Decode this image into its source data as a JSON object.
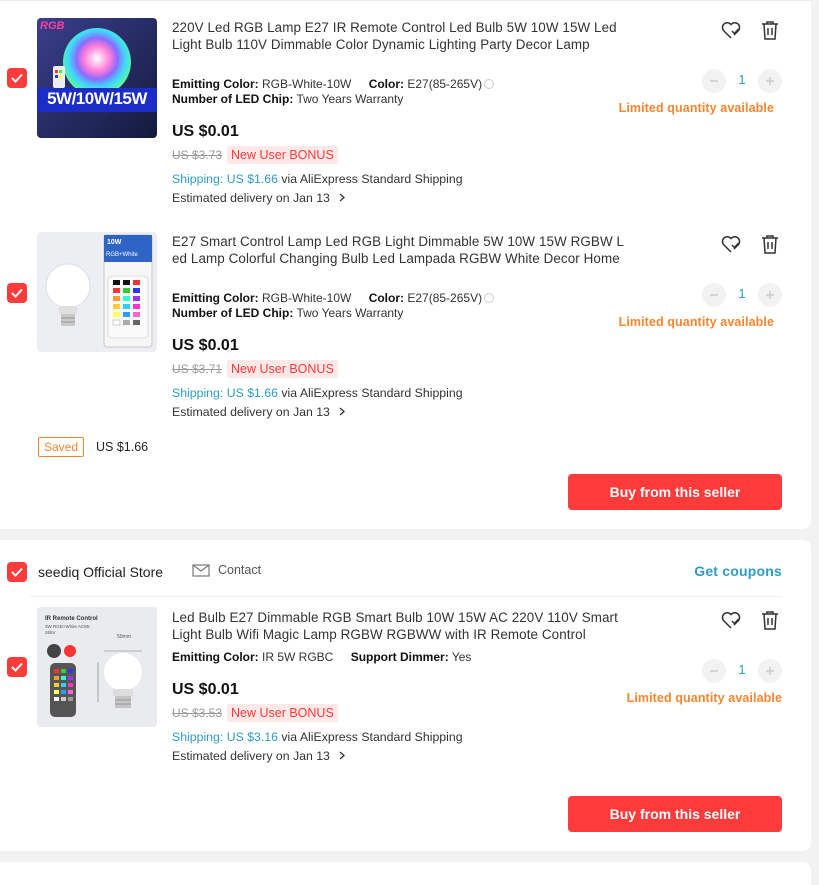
{
  "colors": {
    "accent": "#fd3b3b",
    "link": "#2e9cc3",
    "warning": "#f7852e"
  },
  "seller1": {
    "saved_label": "Saved",
    "saved_amount": "US $1.66",
    "buy_label": "Buy from this seller",
    "items": [
      {
        "title": "220V Led RGB Lamp E27 IR Remote Control Led Bulb 5W 10W 15W Led Light Bulb 110V Dimmable Color Dynamic Lighting Party Decor Lamp",
        "thumb_label_top": "RGB",
        "thumb_label_bottom": "5W/10W/15W",
        "prop1_label": "Emitting Color:",
        "prop1_value": "RGB-White-10W",
        "prop2_label": "Color:",
        "prop2_value": "E27(85-265V)",
        "prop3_label": "Number of LED Chip:",
        "prop3_value": "Two Years Warranty",
        "price": "US $0.01",
        "old_price": "US $3.73",
        "bonus": "New User BONUS",
        "shipping_label": "Shipping: US $1.66",
        "shipping_method": "via AliExpress Standard Shipping",
        "delivery": "Estimated delivery on Jan 13",
        "qty": "1",
        "limited": "Limited quantity available"
      },
      {
        "title": "E27 Smart Control Lamp Led RGB Light Dimmable 5W 10W 15W RGBW Led Lamp Colorful Changing Bulb Led Lampada RGBW White Decor Home",
        "thumb_label_top": "10W",
        "thumb_label_bottom": "RGB+White",
        "prop1_label": "Emitting Color:",
        "prop1_value": "RGB-White-10W",
        "prop2_label": "Color:",
        "prop2_value": "E27(85-265V)",
        "prop3_label": "Number of LED Chip:",
        "prop3_value": "Two Years Warranty",
        "price": "US $0.01",
        "old_price": "US $3.71",
        "bonus": "New User BONUS",
        "shipping_label": "Shipping: US $1.66",
        "shipping_method": "via AliExpress Standard Shipping",
        "delivery": "Estimated delivery on Jan 13",
        "qty": "1",
        "limited": "Limited quantity available"
      }
    ]
  },
  "seller2": {
    "store_name": "seediq Official Store",
    "contact_label": "Contact",
    "coupons_label": "Get coupons",
    "buy_label": "Buy from this seller",
    "item": {
      "title": "Led Bulb E27 Dimmable RGB Smart Bulb 10W 15W AC 220V 110V Smart Light Bulb Wifi Magic Lamp RGBW RGBWW with IR Remote Control",
      "thumb_label_top": "IR Remote Control",
      "thumb_label_mid": "3W RGB+White AC85-265V",
      "thumb_label_size": "50mm",
      "prop1_label": "Emitting Color:",
      "prop1_value": "IR 5W RGBC",
      "prop2_label": "Support Dimmer:",
      "prop2_value": "Yes",
      "price": "US $0.01",
      "old_price": "US $3.53",
      "bonus": "New User BONUS",
      "shipping_label": "Shipping: US $3.16",
      "shipping_method": "via AliExpress Standard Shipping",
      "delivery": "Estimated delivery on Jan 13",
      "qty": "1",
      "limited": "Limited quantity available"
    }
  }
}
